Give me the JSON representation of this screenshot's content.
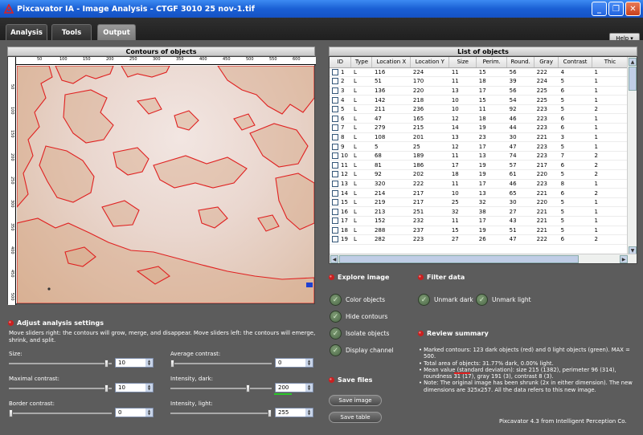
{
  "window": {
    "title": "Pixcavator IA - Image Analysis - CTGF 3010 25 nov-1.tif",
    "controls": [
      "_",
      "❐",
      "✕"
    ]
  },
  "tabs": [
    {
      "label": "Analysis",
      "active": false
    },
    {
      "label": "Tools",
      "active": false
    },
    {
      "label": "Output",
      "active": true
    }
  ],
  "help": {
    "label": "Help"
  },
  "contours": {
    "title": "Contours of objects",
    "ruler_x": [
      "50",
      "100",
      "150",
      "200",
      "250",
      "300",
      "350",
      "400",
      "450",
      "500",
      "550",
      "600"
    ],
    "ruler_y": [
      "50",
      "100",
      "150",
      "200",
      "250",
      "300",
      "350",
      "400",
      "450",
      "500"
    ]
  },
  "list": {
    "title": "List of objects",
    "columns": [
      "ID",
      "Type",
      "Location X",
      "Location Y",
      "Size",
      "Perim.",
      "Round.",
      "Gray",
      "Contrast",
      "Thic"
    ],
    "rows": [
      [
        "1",
        "L",
        "116",
        "224",
        "11",
        "15",
        "56",
        "222",
        "4",
        "1"
      ],
      [
        "2",
        "L",
        "51",
        "170",
        "11",
        "18",
        "39",
        "224",
        "5",
        "1"
      ],
      [
        "3",
        "L",
        "136",
        "220",
        "13",
        "17",
        "56",
        "225",
        "6",
        "1"
      ],
      [
        "4",
        "L",
        "142",
        "218",
        "10",
        "15",
        "54",
        "225",
        "5",
        "1"
      ],
      [
        "5",
        "L",
        "211",
        "236",
        "10",
        "11",
        "92",
        "223",
        "5",
        "2"
      ],
      [
        "6",
        "L",
        "47",
        "165",
        "12",
        "18",
        "46",
        "223",
        "6",
        "1"
      ],
      [
        "7",
        "L",
        "279",
        "215",
        "14",
        "19",
        "44",
        "223",
        "6",
        "1"
      ],
      [
        "8",
        "L",
        "108",
        "201",
        "13",
        "23",
        "30",
        "221",
        "3",
        "1"
      ],
      [
        "9",
        "L",
        "5",
        "25",
        "12",
        "17",
        "47",
        "223",
        "5",
        "1"
      ],
      [
        "10",
        "L",
        "68",
        "189",
        "11",
        "13",
        "74",
        "223",
        "7",
        "2"
      ],
      [
        "11",
        "L",
        "81",
        "186",
        "17",
        "19",
        "57",
        "217",
        "6",
        "2"
      ],
      [
        "12",
        "L",
        "92",
        "202",
        "18",
        "19",
        "61",
        "220",
        "5",
        "2"
      ],
      [
        "13",
        "L",
        "320",
        "222",
        "11",
        "17",
        "46",
        "223",
        "8",
        "1"
      ],
      [
        "14",
        "L",
        "214",
        "217",
        "10",
        "13",
        "65",
        "221",
        "6",
        "2"
      ],
      [
        "15",
        "L",
        "219",
        "217",
        "25",
        "32",
        "30",
        "220",
        "5",
        "1"
      ],
      [
        "16",
        "L",
        "213",
        "251",
        "32",
        "38",
        "27",
        "221",
        "5",
        "1"
      ],
      [
        "17",
        "L",
        "152",
        "232",
        "11",
        "17",
        "43",
        "221",
        "5",
        "1"
      ],
      [
        "18",
        "L",
        "288",
        "237",
        "15",
        "19",
        "51",
        "221",
        "5",
        "1"
      ],
      [
        "19",
        "L",
        "282",
        "223",
        "27",
        "26",
        "47",
        "222",
        "6",
        "2"
      ]
    ]
  },
  "explore": {
    "title": "Explore image",
    "options": [
      "Color objects",
      "Hide contours",
      "Isolate objects",
      "Display channel"
    ]
  },
  "filter": {
    "title": "Filter data",
    "options": [
      "Unmark dark",
      "Unmark light"
    ]
  },
  "save": {
    "title": "Save files",
    "buttons": [
      "Save image",
      "Save table"
    ]
  },
  "review": {
    "title": "Review summary",
    "lines": [
      "• Marked contours: 123 dark objects (red) and 0 light objects (green). MAX = 500.",
      "• Total area of objects: 31.77% dark, 0.00% light.",
      "• Mean value (standard deviation): size 215 (1382), perimeter 96 (314), roundness 31 (17), gray 191 (3), contrast 8 (3).",
      "• Note: The original image has been shrunk (2x in either dimension). The new dimensions are 325x257. All the data refers to this new image."
    ]
  },
  "settings": {
    "title": "Adjust analysis settings",
    "description": "Move sliders right: the contours will grow, merge, and disappear. Move sliders left: the contours will emerge, shrink, and split.",
    "sliders": [
      {
        "label": "Size:",
        "value": "10",
        "level": 0.97
      },
      {
        "label": "Average contrast:",
        "value": "0",
        "level": 0.0
      },
      {
        "label": "Maximal contrast:",
        "value": "10",
        "level": 0.97
      },
      {
        "label": "Intensity, dark:",
        "value": "200",
        "level": 0.78
      },
      {
        "label": "Border contrast:",
        "value": "0",
        "level": 0.0
      },
      {
        "label": "Intensity, light:",
        "value": "255",
        "level": 1.0
      }
    ]
  },
  "footer": {
    "text": "Pixcavator 4.3 from Intelligent Perception Co."
  },
  "colors": {
    "contour": "#e02020",
    "titlebar": "#1f60d6",
    "accent_green": "#2ac62a"
  }
}
